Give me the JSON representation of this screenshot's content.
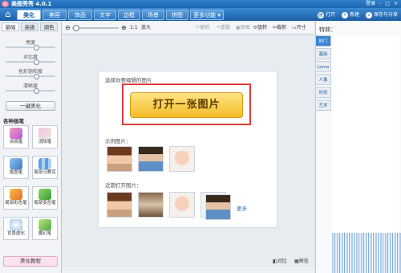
{
  "title_bar": {
    "title": "美图秀秀 4.0.1",
    "login": "登录",
    "controls": [
      "-",
      "□",
      "×"
    ]
  },
  "menu": {
    "tabs": [
      "美化",
      "美容",
      "饰品",
      "文字",
      "边框",
      "场景",
      "拼图"
    ],
    "more": "更多功能 ▾",
    "actions": {
      "open": "打开",
      "new": "新建",
      "save": "保存与分享"
    }
  },
  "left_panel": {
    "tabs": [
      "基础",
      "高级",
      "调色"
    ],
    "sliders": [
      "亮度",
      "对比度",
      "色彩饱和度",
      "清晰度"
    ],
    "one_click": "一键美化",
    "brushes_title": "各种画笔",
    "brushes": [
      "涂鸦笔",
      "消除笔",
      "抠图笔",
      "局部马赛克",
      "局部彩色笔",
      "局部变色笔",
      "背景虚化",
      "魔幻笔"
    ],
    "tutorial": "美化教程"
  },
  "toolbar": {
    "zoom_in": "放大",
    "undo": "撤销",
    "redo": "重做",
    "original": "原图",
    "rotate": "旋转",
    "crop": "裁剪",
    "resize": "尺寸"
  },
  "main": {
    "select_label": "选择你要编辑的图片",
    "open_button": "打开一张图片",
    "sample_label": "示例图片：",
    "recent_label": "近期打开图片：",
    "more": "更多"
  },
  "status": {
    "compare": "对比",
    "preview": "预览"
  },
  "right_panel": {
    "title": "特效：",
    "tabs": [
      "热门",
      "基础",
      "Lomo",
      "人像",
      "时尚",
      "艺术"
    ]
  },
  "colors": {
    "accent": "#2f7fc9",
    "button": "#f3bd26",
    "highlight": "#e03a3a"
  }
}
